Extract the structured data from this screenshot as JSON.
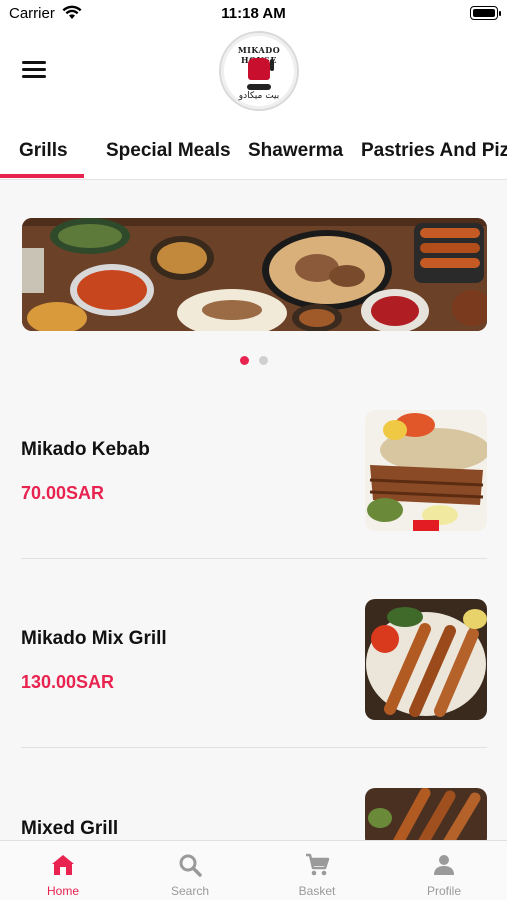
{
  "status_bar": {
    "carrier": "Carrier",
    "time": "11:18 AM"
  },
  "header": {
    "logo": {
      "text_top": "MIKADO HOUSE",
      "text_bottom": "بيت ميكادو"
    },
    "menu_icon": "hamburger-menu-icon"
  },
  "tabs": [
    {
      "label": "Grills",
      "active": true
    },
    {
      "label": "Special Meals",
      "active": false
    },
    {
      "label": "Shawerma",
      "active": false
    },
    {
      "label": "Pastries And Pizza",
      "active": false
    }
  ],
  "banner": {
    "pages": 2,
    "active_page": 1
  },
  "products": [
    {
      "name": "Mikado Kebab",
      "price": "70.00SAR"
    },
    {
      "name": "Mikado Mix Grill",
      "price": "130.00SAR"
    },
    {
      "name": "Mixed Grill",
      "price": ""
    }
  ],
  "bottom_nav": [
    {
      "label": "Home",
      "icon": "home-icon",
      "active": true
    },
    {
      "label": "Search",
      "icon": "search-icon",
      "active": false
    },
    {
      "label": "Basket",
      "icon": "cart-icon",
      "active": false
    },
    {
      "label": "Profile",
      "icon": "person-icon",
      "active": false
    }
  ],
  "colors": {
    "accent": "#e8234f",
    "inactive": "#9a9a9a",
    "background": "#f7f7f7"
  }
}
